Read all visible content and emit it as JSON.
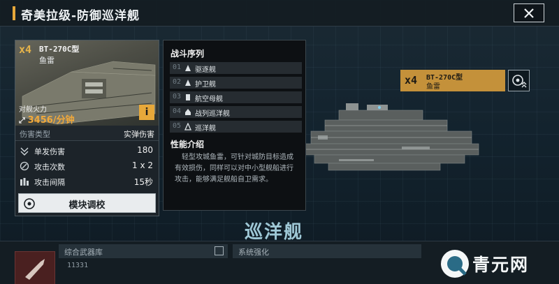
{
  "header": {
    "title": "奇美拉级-防御巡洋舰",
    "close_label": "✕"
  },
  "weapon_card": {
    "count": "x4",
    "name": "BT-270C型",
    "type": "鱼雷",
    "firepower_label": "对舰火力",
    "firepower_value": "3456/分钟",
    "info_label": "i",
    "damage_type_label": "伤害类型",
    "damage_type_value": "实弹伤害",
    "stats": [
      {
        "icon": "single-damage-icon",
        "label": "单发伤害",
        "value": "180"
      },
      {
        "icon": "attack-count-icon",
        "label": "攻击次数",
        "value": "1 x 2"
      },
      {
        "icon": "attack-interval-icon",
        "label": "攻击间隔",
        "value": "15秒"
      }
    ],
    "tune_button": "模块调校"
  },
  "battle_sequence": {
    "title": "战斗序列",
    "items": [
      {
        "num": "01",
        "label": "驱逐舰"
      },
      {
        "num": "02",
        "label": "护卫舰"
      },
      {
        "num": "03",
        "label": "航空母舰"
      },
      {
        "num": "04",
        "label": "战列巡洋舰"
      },
      {
        "num": "05",
        "label": "巡洋舰"
      }
    ]
  },
  "performance": {
    "title": "性能介绍",
    "text": "轻型攻城鱼雷，可针对城防目标造成有效损伤，同样可以对中小型舰船进行攻击，能够满足舰船自卫需求。"
  },
  "ship_tag": {
    "count": "x4",
    "name": "BT-270C型",
    "type": "鱼雷"
  },
  "ship_class": "巡洋舰",
  "bottom": {
    "weapons_label": "综合武器库",
    "weapons_value": "11331",
    "system_label": "系统强化"
  },
  "watermark": "青元网",
  "colors": {
    "accent": "#e7a83a",
    "tag": "#c4913a"
  }
}
